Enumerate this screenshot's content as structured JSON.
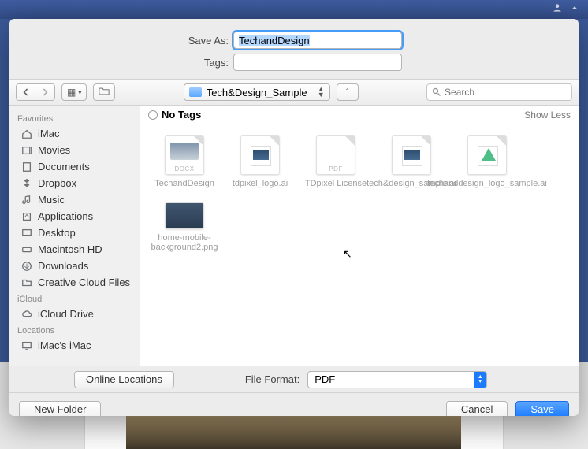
{
  "topright": {},
  "save_as": {
    "label": "Save As:",
    "value": "TechandDesign"
  },
  "tags": {
    "label": "Tags:",
    "value": ""
  },
  "toolbar": {
    "folder": "Tech&Design_Sample",
    "search_placeholder": "Search"
  },
  "sidebar": {
    "sections": [
      {
        "title": "Favorites",
        "items": [
          "iMac",
          "Movies",
          "Documents",
          "Dropbox",
          "Music",
          "Applications",
          "Desktop",
          "Macintosh HD",
          "Downloads",
          "Creative Cloud Files"
        ]
      },
      {
        "title": "iCloud",
        "items": [
          "iCloud Drive"
        ]
      },
      {
        "title": "Locations",
        "items": [
          "iMac's iMac"
        ]
      }
    ]
  },
  "notags": {
    "label": "No Tags",
    "showless": "Show Less"
  },
  "files": [
    {
      "name": "TechandDesign",
      "kind": "DOCX"
    },
    {
      "name": "tdpixel_logo.ai",
      "kind": "AI_B"
    },
    {
      "name": "TDpixel License",
      "kind": "PDF"
    },
    {
      "name": "tech&design_sample.ai",
      "kind": "AI_B"
    },
    {
      "name": "techanddesign_logo_sample.ai",
      "kind": "AI_G"
    },
    {
      "name": "home-mobile-background2.png",
      "kind": "PNG"
    }
  ],
  "format": {
    "online": "Online Locations",
    "label": "File Format:",
    "value": "PDF"
  },
  "buttons": {
    "newfolder": "New Folder",
    "cancel": "Cancel",
    "save": "Save"
  }
}
